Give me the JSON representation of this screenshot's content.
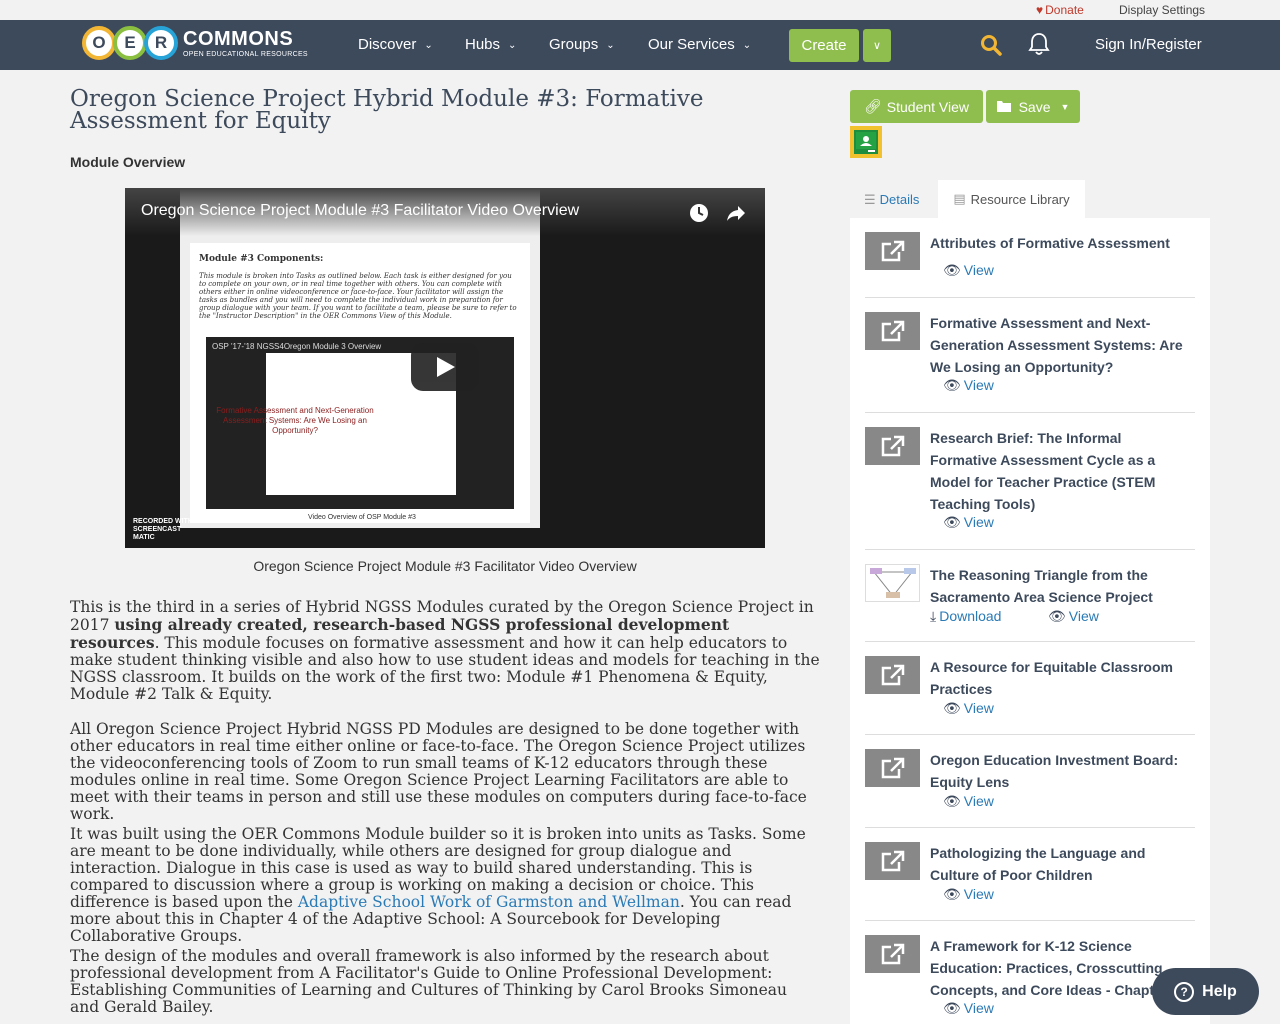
{
  "topbar": {
    "donate": "Donate",
    "display_settings": "Display Settings"
  },
  "logo": {
    "letters": [
      "O",
      "E",
      "R"
    ],
    "name": "COMMONS",
    "tagline": "OPEN EDUCATIONAL RESOURCES"
  },
  "nav": {
    "items": [
      {
        "label": "Discover"
      },
      {
        "label": "Hubs"
      },
      {
        "label": "Groups"
      },
      {
        "label": "Our Services"
      }
    ],
    "create": "Create",
    "signin": "Sign In/Register"
  },
  "page": {
    "title": "Oregon Science Project Hybrid Module #3: Formative Assessment for Equity",
    "section": "Module Overview",
    "video": {
      "title": "Oregon Science Project Module #3 Facilitator Video Overview",
      "components_heading": "Module #3 Components:",
      "components_text": "This module is broken into Tasks as outlined below. Each task is either designed for you to complete on your own, or in real time together with others. You can complete with others either in online videoconference or face-to-face. Your facilitator will assign the tasks as bundles and you will need to complete the individual work in preparation for group dialogue with your team. If you want to facilitate a team, please be sure to refer to the \"Instructor Description\" in the OER Commons View of this Module.",
      "inner_title": "OSP '17-'18 NGSS4Oregon Module 3 Overview",
      "inner_text": "Formative Assessment and Next-Generation Assessment Systems: Are We Losing an Opportunity?",
      "inner_caption": "Video Overview of OSP Module #3",
      "recorded": "RECORDED WITH SCREENCAST MATIC",
      "caption": "Oregon Science Project Module #3 Facilitator Video Overview"
    },
    "paragraphs": {
      "p1_a": "This is the third in a series of Hybrid NGSS Modules curated by the Oregon Science Project in 2017 ",
      "p1_bold": "using already created, research-based NGSS professional development resources",
      "p1_b": ". This module focuses on formative assessment and how it can help educators to make student thinking visible and also how to use student ideas and models for teaching in the NGSS classroom.  It builds on the work of the first two: Module #1 Phenomena & Equity, Module #2 Talk & Equity.",
      "p2": "All Oregon Science Project Hybrid NGSS PD Modules are designed to be done together with other educators in real time either online or face-to-face. The Oregon Science Project utilizes the videoconferencing tools of Zoom to run small teams of K-12 educators through these modules online in real time. Some Oregon Science Project Learning Facilitators are able to meet with their teams in person and still use these modules on computers during face-to-face work.",
      "p3_a": "It was built using the OER Commons Module builder so it is broken into units as Tasks. Some are meant to be done individually, while others are designed for group dialogue and interaction. Dialogue in this case is used as way to build shared understanding. This is compared to discussion where a group is working on making a decision or choice. This difference is based upon the ",
      "p3_link": "Adaptive School Work of Garmston and Wellman",
      "p3_b": ". You can read more about this in Chapter 4 of the Adaptive School: A Sourcebook for Developing Collaborative Groups.",
      "p4": "The design of the modules and overall framework is also informed by the research about professional development from A Facilitator's Guide to Online Professional Development: Establishing Communities of Learning and Cultures of Thinking by Carol Brooks Simoneau and Gerald Bailey."
    }
  },
  "sidebar": {
    "student_view": "Student View",
    "save": "Save",
    "tabs": {
      "details": "Details",
      "library": "Resource Library"
    },
    "resources": [
      {
        "title": "Attributes of Formative Assessment",
        "view": "View"
      },
      {
        "title": "Formative Assessment and Next-Generation Assessment Systems: Are We Losing an Opportunity?",
        "view": "View"
      },
      {
        "title": "Research Brief: The Informal Formative Assessment Cycle as a Model for Teacher Practice (STEM Teaching Tools)",
        "view": "View"
      },
      {
        "title": "The Reasoning Triangle from the Sacramento Area Science Project",
        "download": "Download",
        "view": "View"
      },
      {
        "title": "A Resource for Equitable Classroom Practices",
        "view": "View"
      },
      {
        "title": "Oregon Education Investment Board: Equity Lens",
        "view": "View"
      },
      {
        "title": "Pathologizing the Language and Culture of Poor Children",
        "view": "View"
      },
      {
        "title": "A Framework for K-12 Science Education: Practices, Crosscutting Concepts, and Core Ideas - Chapter 11",
        "view": "View"
      }
    ]
  },
  "help": {
    "label": "Help"
  }
}
